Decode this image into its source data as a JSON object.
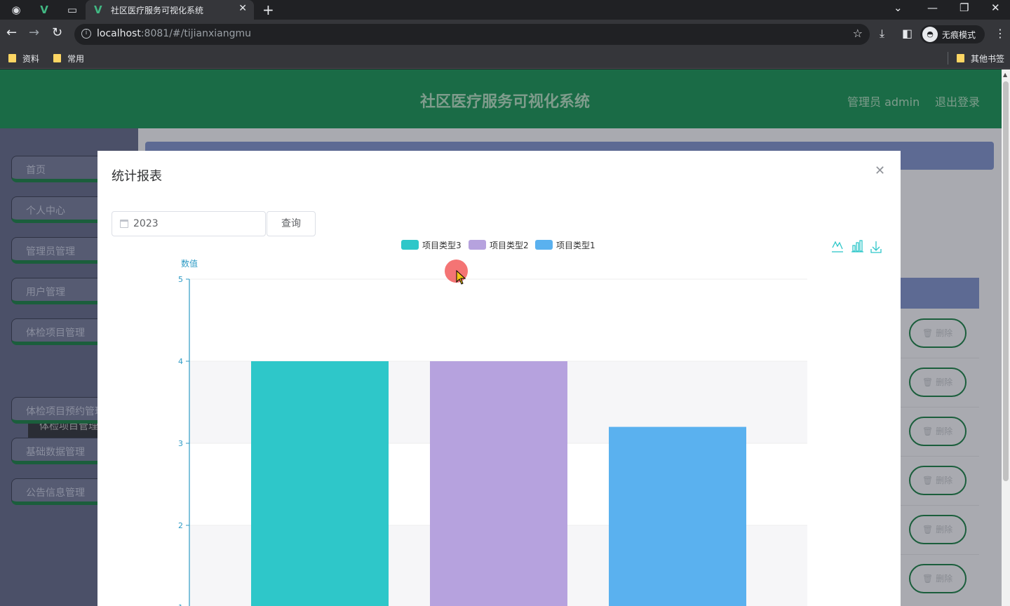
{
  "browser": {
    "tab_title": "社区医疗服务可视化系统",
    "url_host": "localhost",
    "url_rest": ":8081/#/tijianxiangmu",
    "incognito_label": "无痕模式",
    "bookmarks": [
      "资料",
      "常用"
    ],
    "other_bookmarks": "其他书签"
  },
  "header": {
    "title": "社区医疗服务可视化系统",
    "user": "管理员 admin",
    "logout": "退出登录"
  },
  "sidebar": {
    "items": [
      {
        "label": "首页"
      },
      {
        "label": "个人中心"
      },
      {
        "label": "管理员管理"
      },
      {
        "label": "用户管理"
      },
      {
        "label": "体检项目管理"
      },
      {
        "label": "体检项目预约管理"
      },
      {
        "label": "基础数据管理"
      },
      {
        "label": "公告信息管理"
      }
    ],
    "submenu_label": "体检项目管理"
  },
  "table": {
    "delete_label": "删除"
  },
  "dialog": {
    "title": "统计报表",
    "year_value": "2023",
    "query_label": "查询"
  },
  "chart_data": {
    "type": "bar",
    "title": "",
    "ylabel": "数值",
    "ylim": [
      0,
      5
    ],
    "yticks": [
      "1",
      "2",
      "3",
      "4",
      "5"
    ],
    "categories": [],
    "series": [
      {
        "name": "项目类型3",
        "values": [
          4
        ],
        "color": "#2ec7c9"
      },
      {
        "name": "项目类型2",
        "values": [
          4
        ],
        "color": "#b6a2de"
      },
      {
        "name": "项目类型1",
        "values": [
          3.2
        ],
        "color": "#5ab1ef"
      }
    ],
    "legend_position": "top",
    "toolbox_icons": [
      "line-chart-icon",
      "bar-chart-icon",
      "download-icon"
    ]
  }
}
